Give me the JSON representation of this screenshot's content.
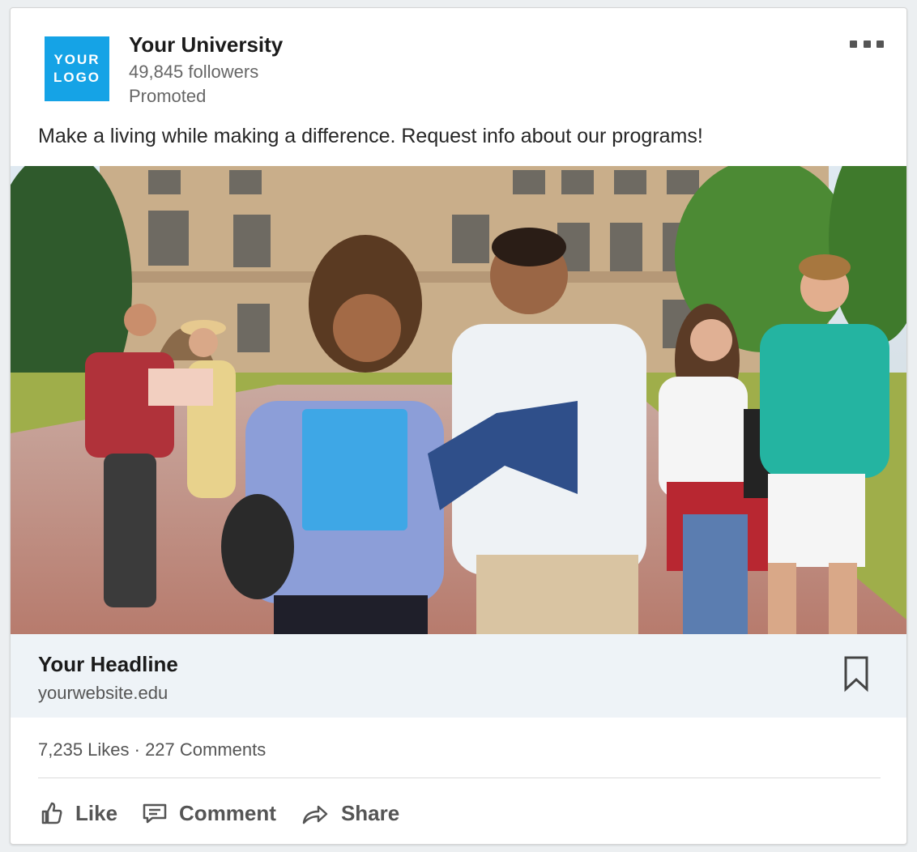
{
  "post": {
    "logo_line1": "YOUR",
    "logo_line2": "LOGO",
    "org_name": "Your University",
    "followers": "49,845 followers",
    "promoted": "Promoted",
    "text": "Make a living while making a difference. Request info about our programs!"
  },
  "link": {
    "headline": "Your Headline",
    "website": "yourwebsite.edu"
  },
  "social": {
    "stats": "7,235 Likes · 227 Comments"
  },
  "actions": {
    "like": "Like",
    "comment": "Comment",
    "share": "Share"
  },
  "colors": {
    "logo_bg": "#15a3e6",
    "headline_bar_bg": "#eef3f7",
    "icon_gray": "#555555"
  }
}
